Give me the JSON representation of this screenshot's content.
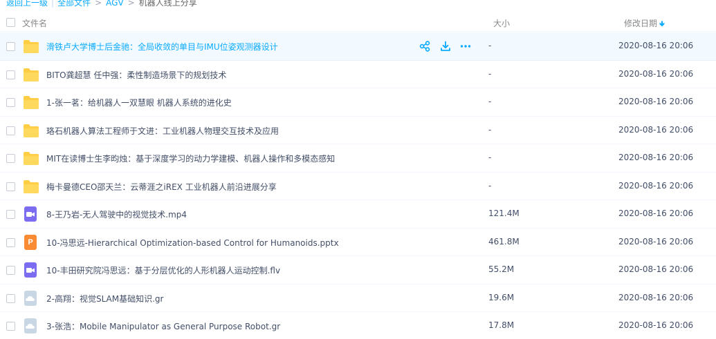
{
  "breadcrumb": {
    "back": "返回上一级",
    "all_files": "全部文件",
    "level1": "AGV",
    "current": "机器人线上分享"
  },
  "columns": {
    "name": "文件名",
    "size": "大小",
    "date": "修改日期"
  },
  "colors": {
    "accent": "#09aaff",
    "folder": "#ffce45",
    "video": "#7b6cf2",
    "ppt": "#f98b35",
    "gr": "#c9d6e3"
  },
  "files": [
    {
      "type": "folder",
      "icon": "folder-icon",
      "name": "滑铁卢大学博士后金驰：全局收敛的单目与IMU位姿观测器设计",
      "size": "-",
      "date": "2020-08-16 20:06",
      "hover": true
    },
    {
      "type": "folder",
      "icon": "folder-icon",
      "name": "BITO龚超慧 任中强：柔性制造场景下的规划技术",
      "size": "-",
      "date": "2020-08-16 20:06"
    },
    {
      "type": "folder",
      "icon": "folder-icon",
      "name": "1-张一茗：给机器人一双慧眼 机器人系统的进化史",
      "size": "-",
      "date": "2020-08-16 20:06"
    },
    {
      "type": "folder",
      "icon": "folder-icon",
      "name": "珞石机器人算法工程师于文进：工业机器人物理交互技术及应用",
      "size": "-",
      "date": "2020-08-16 20:06"
    },
    {
      "type": "folder",
      "icon": "folder-icon",
      "name": "MIT在读博士生李昀烛：基于深度学习的动力学建模、机器人操作和多模态感知",
      "size": "-",
      "date": "2020-08-16 20:06"
    },
    {
      "type": "folder",
      "icon": "folder-icon",
      "name": "梅卡曼德CEO邵天兰：云蒂涯之iREX 工业机器人前沿进展分享",
      "size": "-",
      "date": "2020-08-16 20:06"
    },
    {
      "type": "video",
      "icon": "video-file-icon",
      "name": "8-王乃岩-无人驾驶中的视觉技术.mp4",
      "size": "121.4M",
      "date": "2020-08-16 20:06"
    },
    {
      "type": "ppt",
      "icon": "ppt-file-icon",
      "glyph": "P",
      "name": "10-冯思远-Hierarchical Optimization-based Control for Humanoids.pptx",
      "size": "461.8M",
      "date": "2020-08-16 20:06"
    },
    {
      "type": "video",
      "icon": "video-file-icon",
      "name": "10-丰田研究院冯思远：基于分层优化的人形机器人运动控制.flv",
      "size": "55.2M",
      "date": "2020-08-16 20:06"
    },
    {
      "type": "gr",
      "icon": "cloud-file-icon",
      "name": "2-高翔：视觉SLAM基础知识.gr",
      "size": "19.6M",
      "date": "2020-08-16 20:06"
    },
    {
      "type": "gr",
      "icon": "cloud-file-icon",
      "name": "3-张浩：Mobile Manipulator as General Purpose Robot.gr",
      "size": "17.8M",
      "date": "2020-08-16 20:06"
    }
  ]
}
